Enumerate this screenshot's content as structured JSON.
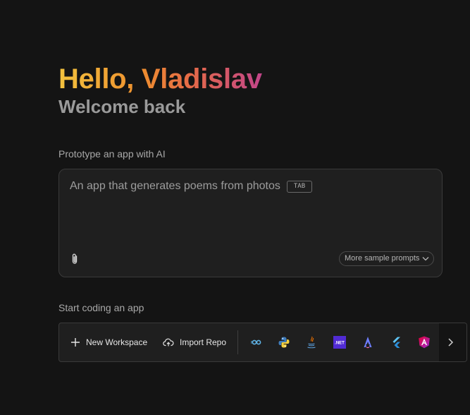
{
  "header": {
    "greeting": "Hello, Vladislav",
    "subtitle": "Welcome back"
  },
  "prototype": {
    "section_label": "Prototype an app with AI",
    "prompt_placeholder": "An app that generates poems from photos",
    "tab_hint": "TAB",
    "attach_icon": "paperclip-icon",
    "sample_prompts_label": "More sample prompts"
  },
  "coding": {
    "section_label": "Start coding an app",
    "new_workspace_label": "New Workspace",
    "import_repo_label": "Import Repo",
    "templates": [
      {
        "name": "go-icon"
      },
      {
        "name": "python-icon"
      },
      {
        "name": "java-icon"
      },
      {
        "name": "dotnet-icon",
        "badge": ".NET"
      },
      {
        "name": "astro-icon"
      },
      {
        "name": "flutter-icon"
      },
      {
        "name": "angular-icon"
      }
    ],
    "next_icon": "chevron-right-icon"
  },
  "colors": {
    "background": "#141414",
    "panel": "#1f1f1f",
    "greeting_gradient": [
      "#f2c23e",
      "#ee8f2e",
      "#e56a48",
      "#c2458a"
    ]
  }
}
